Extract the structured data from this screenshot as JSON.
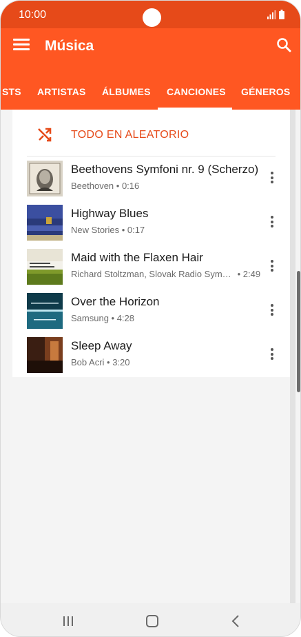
{
  "status_bar": {
    "time": "10:00"
  },
  "app_bar": {
    "title": "Música"
  },
  "tabs": [
    {
      "label": "STS"
    },
    {
      "label": "ARTISTAS"
    },
    {
      "label": "ÁLBUMES"
    },
    {
      "label": "CANCIONES",
      "active": true
    },
    {
      "label": "GÉNEROS"
    }
  ],
  "shuffle": {
    "label": "TODO EN ALEATORIO"
  },
  "songs": [
    {
      "title": "Beethovens Symfoni nr. 9 (Scherzo)",
      "artist": "Beethoven",
      "duration": "0:16"
    },
    {
      "title": "Highway Blues",
      "artist": "New Stories",
      "duration": "0:17"
    },
    {
      "title": "Maid with the Flaxen Hair",
      "artist": "Richard Stoltzman, Slovak Radio Symphony Orchestra",
      "duration": "2:49"
    },
    {
      "title": "Over the Horizon",
      "artist": "Samsung",
      "duration": "4:28"
    },
    {
      "title": "Sleep Away",
      "artist": "Bob Acri",
      "duration": "3:20"
    }
  ],
  "colors": {
    "primary": "#ff5722",
    "status_bar": "#e64a19",
    "accent_text": "#e64a19"
  },
  "icons": [
    "menu-icon",
    "search-icon",
    "shuffle-icon",
    "more-vert-icon",
    "recent-apps-icon",
    "home-icon",
    "back-icon"
  ]
}
